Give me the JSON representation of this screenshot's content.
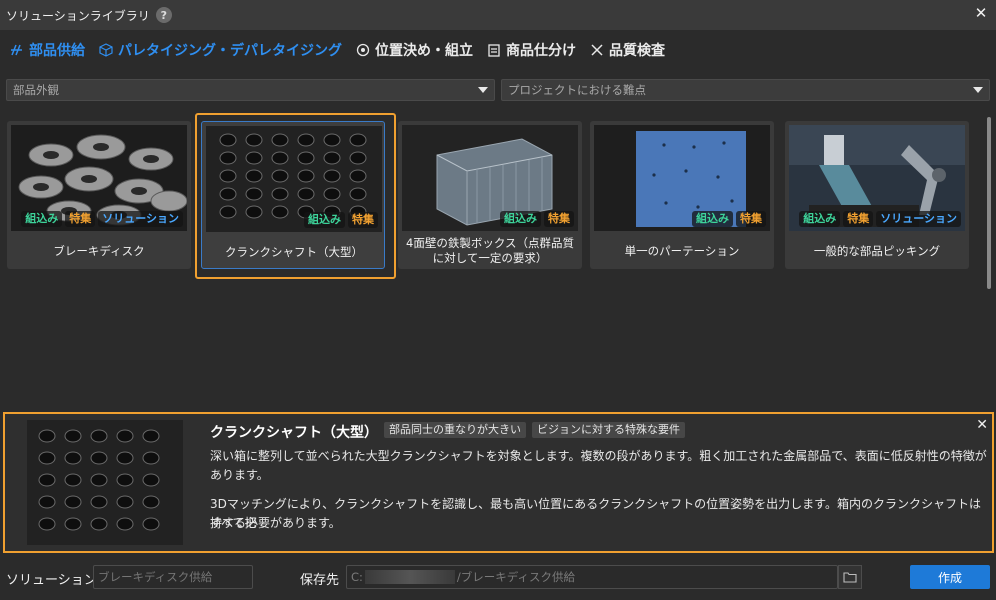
{
  "window": {
    "title": "ソリューションライブラリ",
    "help": "?",
    "close": "✕"
  },
  "tabs": [
    {
      "label": "部品供給",
      "icon": "parts-icon",
      "active": true
    },
    {
      "label": "パレタイジング・デパレタイジング",
      "icon": "box-icon",
      "active": true
    },
    {
      "label": "位置決め・組立",
      "icon": "target-icon",
      "active": false
    },
    {
      "label": "商品仕分け",
      "icon": "clipboard-icon",
      "active": false
    },
    {
      "label": "品質検査",
      "icon": "tools-icon",
      "active": false
    }
  ],
  "filters": {
    "category": "部品外観",
    "difficulty": "プロジェクトにおける難点"
  },
  "cards": [
    {
      "label": "ブレーキディスク",
      "badges": [
        "組込み",
        "特集",
        "ソリューション"
      ]
    },
    {
      "label": "クランクシャフト（大型）",
      "badges": [
        "組込み",
        "特集"
      ]
    },
    {
      "label": "4面壁の鉄製ボックス（点群品質に対して一定の要求）",
      "badges": [
        "組込み",
        "特集"
      ]
    },
    {
      "label": "単一のパーテーション",
      "badges": [
        "組込み",
        "特集"
      ]
    },
    {
      "label": "一般的な部品ピッキング",
      "badges": [
        "組込み",
        "特集",
        "ソリューション"
      ]
    }
  ],
  "badge_colors": {
    "組込み": "#3dd39a",
    "特集": "#f0a030",
    "ソリューション": "#4aa8ff"
  },
  "detail": {
    "title": "クランクシャフト（大型）",
    "tags": [
      "部品同士の重なりが大きい",
      "ビジョンに対する特殊な要件"
    ],
    "para1_line1": "深い箱に整列して並べられた大型クランクシャフトを対象とします。複数の段があります。粗く加工された金属部品で、表面に低反射性の特徴が",
    "para1_line2": "あります。",
    "para2_line1": "3Dマッチングにより、クランクシャフトを認識し、最も高い位置にあるクランクシャフトの位置姿勢を出力します。箱内のクランクシャフトはすべて把",
    "para2_line2": "持する必要があります。",
    "close": "✕"
  },
  "footer": {
    "name_label": "ソリューション名",
    "name_placeholder": "ブレーキディスク供給",
    "save_label": "保存先",
    "path_prefix": "C:",
    "path_suffix": "/ブレーキディスク供給",
    "create_label": "作成"
  },
  "colors": {
    "accent": "#2f8ff1",
    "selection": "#f0a030",
    "button": "#1e7ad8"
  }
}
